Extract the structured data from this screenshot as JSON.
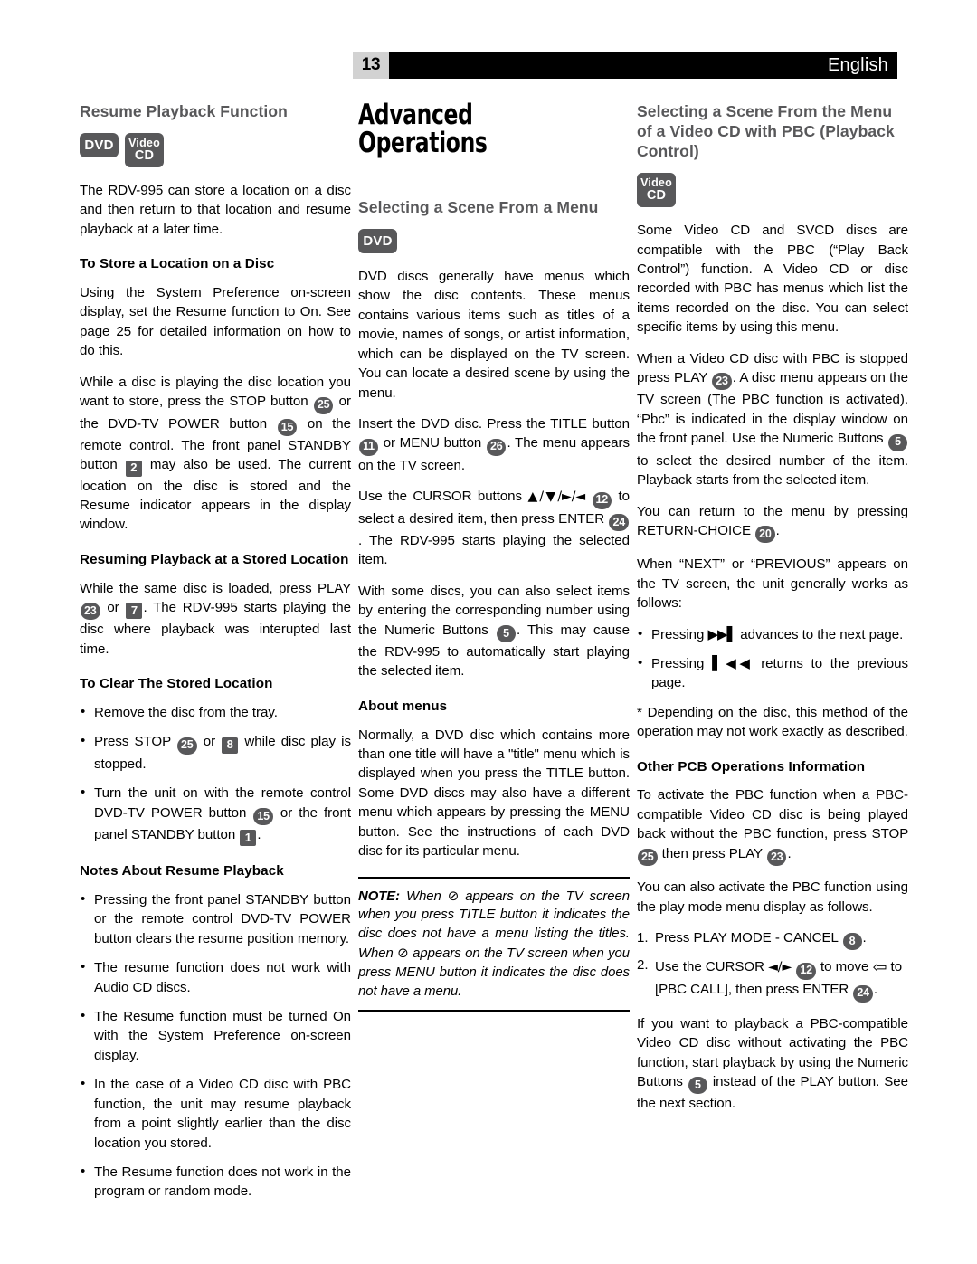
{
  "header": {
    "page_number": "13",
    "language": "English"
  },
  "left_column": {
    "section_title": "Resume Playback Function",
    "disc_badges": [
      {
        "name": "dvd",
        "line1": "DVD"
      },
      {
        "name": "video-cd",
        "line1": "Video",
        "line2": "CD"
      }
    ],
    "intro": "The RDV-995 can store a location on a disc and then return to that location and resume playback at a later time.",
    "sub1_title": "To Store a Location on a Disc",
    "sub1_p1": "Using the System Preference on-screen display, set the Resume function to On. See page 25 for detailed information on how to do this.",
    "sub1_p2_a": "While a disc is playing the disc location you want to store, press the STOP button",
    "sub1_p2_b": "or the DVD-TV POWER button",
    "sub1_p2_c": "on the remote control. The front panel STANDBY button",
    "sub1_p2_d": "may also be used. The current location on the disc is stored and the Resume indicator appears in the display window.",
    "sub1_btn_stop": "25",
    "sub1_btn_power": "15",
    "sub1_btn_standby": "2",
    "sub2_title": "Resuming Playback at a Stored Location",
    "sub2_p_a": "While the same disc is loaded, press PLAY",
    "sub2_p_b": "or",
    "sub2_p_c": ". The RDV-995 starts playing the disc where playback was interupted last time.",
    "sub2_btn_play": "23",
    "sub2_btn_front_play": "7",
    "sub3_title": "To Clear The Stored Location",
    "sub3_bullets": [
      {
        "a": "Remove the disc from the tray.",
        "b": "",
        "c": ""
      },
      {
        "a": "Press STOP",
        "btn1": "25",
        "b": "or",
        "btn2": "8",
        "c": "while disc play is stopped."
      },
      {
        "a": "Turn the unit on with the remote control DVD-TV POWER button",
        "btn1": "15",
        "b": "or the front panel STANDBY button",
        "btn2": "1",
        "c": "."
      }
    ],
    "sub4_title": "Notes About Resume Playback",
    "sub4_bullets": [
      "Pressing the front panel STANDBY button or the remote control DVD-TV POWER button clears the resume position memory.",
      "The resume function does not work with Audio CD discs.",
      "The Resume function must be turned On with the System Preference on-screen display.",
      "In the case of a Video CD disc with PBC function, the unit may resume playback from a point slightly earlier than the disc location you stored.",
      "The Resume function does not work in the program or random mode."
    ]
  },
  "middle_column": {
    "chapter_title": "Advanced Operations",
    "section_title": "Selecting a Scene From a Menu",
    "disc_badges": [
      {
        "name": "dvd",
        "line1": "DVD"
      }
    ],
    "p1": "DVD discs generally have menus which show the disc contents. These menus contains various items such as titles of a movie, names of songs, or artist information, which can be displayed on the TV screen. You can locate a desired scene by using the menu.",
    "p2_a": "Insert the DVD disc. Press the TITLE button",
    "p2_b": "or MENU button",
    "p2_c": ". The menu appears on the TV screen.",
    "p2_btn_title": "11",
    "p2_btn_menu": "26",
    "p3_a": "Use the CURSOR buttons",
    "p3_cursor": "▲/▼/►/◄",
    "p3_btn_cursor": "12",
    "p3_b": "to select a desired item, then press ENTER",
    "p3_btn_enter": "24",
    "p3_c": ". The RDV-995 starts playing the selected item.",
    "p4_a": "With some discs, you can also select items by entering the corresponding number using the Numeric Buttons",
    "p4_btn_numeric": "5",
    "p4_b": ". This may cause the RDV-995 to automatically start playing the selected item.",
    "sub1_title": "About menus",
    "sub1_p": "Normally, a DVD disc which contains more than one title will have a \"title\" menu which is displayed when you press the TITLE button. Some DVD discs may also have a different menu which appears by pressing the MENU button. See the instructions of each DVD disc for its particular menu.",
    "note_label": "NOTE:",
    "note_a": "When",
    "note_symbol": "⊘",
    "note_b": "appears on the TV screen when you press TITLE button it indicates the disc does not have a menu listing the titles. When",
    "note_c": "appears on the TV screen when you press MENU button it indicates the disc does not have a menu."
  },
  "right_column": {
    "section_title": "Selecting a Scene From the Menu of a Video CD with PBC (Playback Control)",
    "disc_badges": [
      {
        "name": "video-cd",
        "line1": "Video",
        "line2": "CD"
      }
    ],
    "p1": "Some Video CD and SVCD discs are compatible with the PBC (“Play Back Control”) function. A Video CD or disc recorded with PBC has menus which list the items recorded on the disc. You can select specific items by using this menu.",
    "p2_a": "When a Video CD disc with PBC is stopped press PLAY",
    "p2_btn_play": "23",
    "p2_b": ". A disc menu appears on the TV screen (The PBC function is activated). “Pbc” is indicated in the display window on the front panel. Use the Numeric Buttons",
    "p2_btn_numeric": "5",
    "p2_c": "to select the desired number of the item. Playback starts from the selected item.",
    "p3_a": "You can return to the menu by pressing RETURN-CHOICE",
    "p3_btn_return": "20",
    "p3_b": ".",
    "p4": "When “NEXT” or “PREVIOUS” appears on the TV screen, the unit generally works as follows:",
    "bullets": [
      {
        "a": "Pressing",
        "glyph": "▶▶▌",
        "b": "advances to the next page."
      },
      {
        "a": "Pressing",
        "glyph": "▌◀◀",
        "b": "returns to the previous page."
      }
    ],
    "footnote": "* Depending on the disc, this method of the operation may not work exactly as described.",
    "sub1_title": "Other PCB Operations Information",
    "sub1_p_a": "To activate the PBC function when a PBC-compatible Video CD disc is being played back without the PBC function, press STOP",
    "sub1_btn_stop": "25",
    "sub1_p_b": "then press PLAY",
    "sub1_btn_play": "23",
    "sub1_p_c": ".",
    "p5": "You can also activate the PBC function using the play mode menu display as follows.",
    "steps": [
      {
        "num": "1.",
        "a": "Press PLAY MODE - CANCEL",
        "btn": "8",
        "b": "."
      },
      {
        "num": "2.",
        "a": "Use the CURSOR",
        "cursor": "◄/►",
        "btn": "12",
        "b": "to move",
        "arrow": "⇦",
        "c": "to [PBC CALL], then press ENTER",
        "btn2": "24",
        "d": "."
      }
    ],
    "p6_a": "If you want to playback a PBC-compatible Video CD disc without activating the PBC function, start playback by using the Numeric Buttons",
    "p6_btn_numeric": "5",
    "p6_b": "instead of the PLAY button. See the next section."
  },
  "colors": {
    "badge_gray": "#58585a",
    "header_black": "#000000",
    "pagenum_gray": "#d2d2d2",
    "heading_gray": "#58585a"
  }
}
